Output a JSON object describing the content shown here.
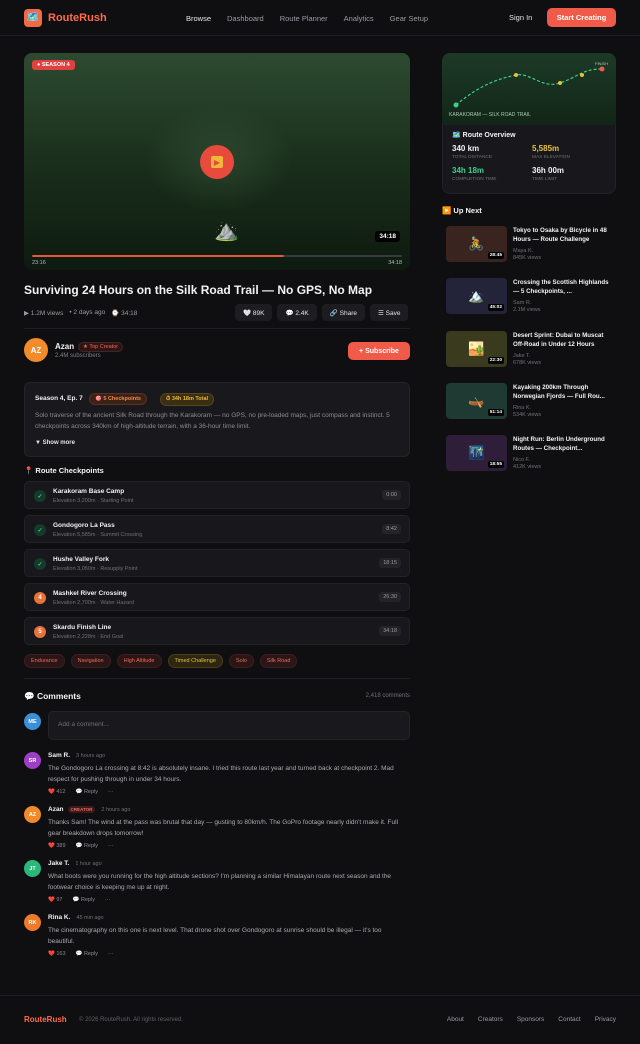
{
  "brand": {
    "name": "RouteRush",
    "logo_icon": "🗺️"
  },
  "nav": [
    "Browse",
    "Dashboard",
    "Route Planner",
    "Analytics",
    "Gear Setup"
  ],
  "header": {
    "signin": "Sign In",
    "cta": "Start Creating"
  },
  "player": {
    "badge": "● SEASON 4",
    "duration": "34:18",
    "elapsed": "23:16",
    "total": "34:18",
    "progress": 0.68
  },
  "video": {
    "title": "Surviving 24 Hours on the Silk Road Trail — No GPS, No Map",
    "views": "▶ 1.2M views",
    "age": "• 2 days ago",
    "length": "⌚ 34:18",
    "likes": "🤍 89K",
    "comments": "💬 2.4K",
    "share": "🔗 Share",
    "save": "☰ Save"
  },
  "channel": {
    "initials": "AZ",
    "name": "Azan",
    "badge": "★ Top Creator",
    "subs": "2.4M subscribers",
    "subscribe": "+ Subscribe"
  },
  "description": {
    "episode": "Season 4, Ep. 7",
    "checkpoints": "🎯 5 Checkpoints",
    "total": "⏱ 34h 18m Total",
    "text": "Solo traverse of the ancient Silk Road through the Karakoram — no GPS, no pre-loaded maps, just compass and instinct. 5 checkpoints across 340km of high-altitude terrain, with a 36-hour time limit.",
    "more": "▼ Show more"
  },
  "checkpoints_title": "📍 Route Checkpoints",
  "checkpoints": [
    {
      "icon": "✓",
      "name": "Karakoram Base Camp",
      "sub": "Elevation 3,200m · Starting Point",
      "time": "0:00"
    },
    {
      "icon": "✓",
      "name": "Gondogoro La Pass",
      "sub": "Elevation 5,585m · Summit Crossing",
      "time": "8:42"
    },
    {
      "icon": "✓",
      "name": "Hushe Valley Fork",
      "sub": "Elevation 3,050m · Resupply Point",
      "time": "18:15"
    },
    {
      "icon": "4",
      "name": "Mashkel River Crossing",
      "sub": "Elevation 2,700m · Water Hazard",
      "time": "26:30"
    },
    {
      "icon": "5",
      "name": "Skardu Finish Line",
      "sub": "Elevation 2,228m · End Goal",
      "time": "34:18"
    }
  ],
  "tags": [
    "Endurance",
    "Navigation",
    "High Altitude",
    "Timed Challenge",
    "Solo",
    "Silk Road"
  ],
  "comments_section": {
    "title": "💬 Comments",
    "count": "2,418 comments",
    "me": "ME",
    "placeholder": "Add a comment..."
  },
  "comments": [
    {
      "initials": "SR",
      "name": "Sam R.",
      "time": "3 hours ago",
      "creator": "",
      "text": "The Gondogoro La crossing at 8:42 is absolutely insane. I tried this route last year and turned back at checkpoint 2. Mad respect for pushing through in under 34 hours.",
      "likes": "❤️ 412",
      "reply": "💬 Reply",
      "more": "···"
    },
    {
      "initials": "AZ",
      "name": "Azan",
      "time": "2 hours ago",
      "creator": "CREATOR",
      "text": "Thanks Sam! The wind at the pass was brutal that day — gusting to 80km/h. The GoPro footage nearly didn't make it. Full gear breakdown drops tomorrow!",
      "likes": "❤️ 389",
      "reply": "💬 Reply",
      "more": "···"
    },
    {
      "initials": "JT",
      "name": "Jake T.",
      "time": "1 hour ago",
      "creator": "",
      "text": "What boots were you running for the high altitude sections? I'm planning a similar Himalayan route next season and the footwear choice is keeping me up at night.",
      "likes": "❤️ 97",
      "reply": "💬 Reply",
      "more": "···"
    },
    {
      "initials": "RK",
      "name": "Rina K.",
      "time": "45 min ago",
      "creator": "",
      "text": "The cinematography on this one is next level. That drone shot over Gondogoro at sunrise should be illegal — it's too beautiful.",
      "likes": "❤️ 163",
      "reply": "💬 Reply",
      "more": "···"
    }
  ],
  "route_overview": {
    "map_label": "KARAKORAM — SILK ROAD TRAIL",
    "finish": "FINISH",
    "title": "🗺️ Route Overview",
    "stats": [
      {
        "value": "340 km",
        "label": "TOTAL DISTANCE",
        "color": "#f2f2f4"
      },
      {
        "value": "5,585m",
        "label": "MAX ELEVATION",
        "color": "#e8c23a"
      },
      {
        "value": "34h 18m",
        "label": "COMPLETION TIME",
        "color": "#3ad08a"
      },
      {
        "value": "36h 00m",
        "label": "TIME LIMIT",
        "color": "#f2f2f4"
      }
    ]
  },
  "up_next_title": "▶️ Up Next",
  "up_next": [
    {
      "title": "Tokyo to Osaka by Bicycle in 48 Hours — Route Challenge",
      "author": "Maya K.",
      "views": "845K views",
      "duration": "28:45",
      "icon": "🚴",
      "bg": "#3a2420"
    },
    {
      "title": "Crossing the Scottish Highlands — 5 Checkpoints, ...",
      "author": "Sam R.",
      "views": "2.1M views",
      "duration": "45:02",
      "icon": "🏔️",
      "bg": "#23233a"
    },
    {
      "title": "Desert Sprint: Dubai to Muscat Off-Road in Under 12 Hours",
      "author": "Jake T.",
      "views": "678K views",
      "duration": "22:30",
      "icon": "🏜️",
      "bg": "#3a3a1e"
    },
    {
      "title": "Kayaking 200km Through Norwegian Fjords — Full Rou...",
      "author": "Rina K.",
      "views": "534K views",
      "duration": "51:14",
      "icon": "🛶",
      "bg": "#1e3a32"
    },
    {
      "title": "Night Run: Berlin Underground Routes — Checkpoint...",
      "author": "Nico F.",
      "views": "412K views",
      "duration": "18:55",
      "icon": "🌃",
      "bg": "#2e1e3a"
    }
  ],
  "footer": {
    "logo": "RouteRush",
    "copy": "© 2026 RouteRush. All rights reserved.",
    "links": [
      "About",
      "Creators",
      "Sponsors",
      "Contact",
      "Privacy"
    ]
  }
}
